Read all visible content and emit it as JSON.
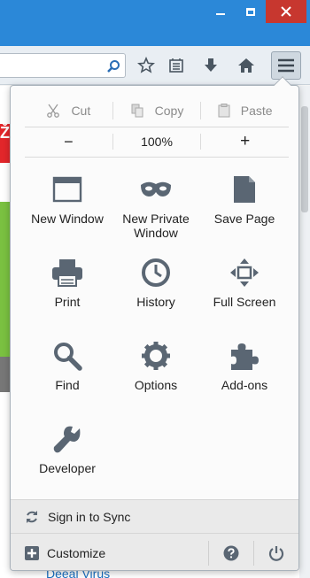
{
  "window": {
    "minimize_icon": "minimize-icon",
    "maximize_icon": "maximize-icon",
    "close_icon": "close-icon"
  },
  "toolbar": {
    "url_value": "",
    "icons": [
      "search-icon",
      "bookmark-star-icon",
      "reading-list-icon",
      "download-icon",
      "home-icon",
      "hamburger-menu-icon"
    ]
  },
  "menu": {
    "edit": {
      "cut": "Cut",
      "copy": "Copy",
      "paste": "Paste"
    },
    "zoom": {
      "minus": "−",
      "level": "100%",
      "plus": "+"
    },
    "items": [
      {
        "label": "New Window",
        "icon": "new-window-icon"
      },
      {
        "label": "New Private Window",
        "icon": "private-mask-icon"
      },
      {
        "label": "Save Page",
        "icon": "save-page-icon"
      },
      {
        "label": "Print",
        "icon": "printer-icon"
      },
      {
        "label": "History",
        "icon": "clock-icon"
      },
      {
        "label": "Full Screen",
        "icon": "fullscreen-icon"
      },
      {
        "label": "Find",
        "icon": "magnifier-icon"
      },
      {
        "label": "Options",
        "icon": "gear-icon"
      },
      {
        "label": "Add-ons",
        "icon": "puzzle-icon"
      },
      {
        "label": "Developer",
        "icon": "wrench-icon"
      }
    ],
    "sync": "Sign in to Sync",
    "customize": "Customize"
  },
  "page": {
    "link_text": "Deeal Virus",
    "red_badge": "Ž"
  },
  "colors": {
    "titlebar": "#2b88d8",
    "close": "#c7372f",
    "icon_gray": "#5a6673"
  }
}
